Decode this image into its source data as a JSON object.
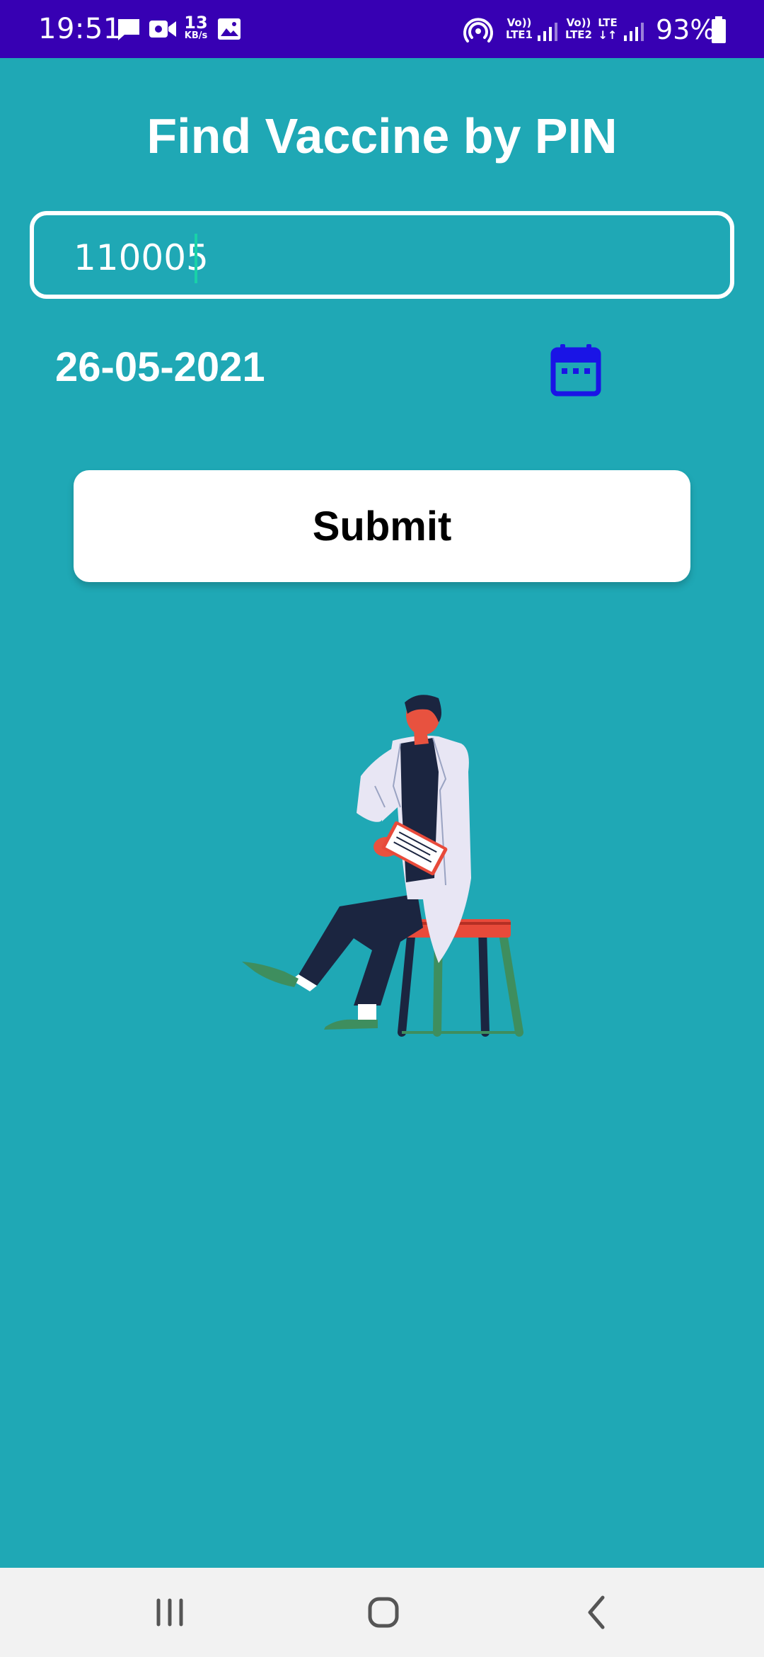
{
  "status_bar": {
    "time": "19:51",
    "net_speed_value": "13",
    "net_speed_unit": "KB/s",
    "sim1_label_top": "Vo))",
    "sim1_label_bottom": "LTE1",
    "sim2_label_top": "Vo))",
    "sim2_label_bottom": "LTE2",
    "sim2_data_label": "LTE",
    "battery_percent": "93%",
    "icons": [
      "message-icon",
      "video-call-icon",
      "image-icon",
      "hotspot-icon",
      "signal-icon",
      "battery-icon"
    ]
  },
  "main": {
    "title": "Find Vaccine by PIN",
    "pin_input": {
      "value": "110005"
    },
    "date": "26-05-2021",
    "calendar_icon": "calendar-icon",
    "submit_label": "Submit",
    "illustration": "seated-doctor-illustration"
  },
  "navigation_bar": {
    "icons": [
      "recent-apps-icon",
      "home-icon",
      "back-icon"
    ]
  },
  "colors": {
    "status_bar": "#3700b3",
    "background": "#1fa8b5",
    "calendar_icon": "#1a14e6",
    "cursor": "#18d2a8",
    "nav_bar": "#f2f2f2"
  }
}
